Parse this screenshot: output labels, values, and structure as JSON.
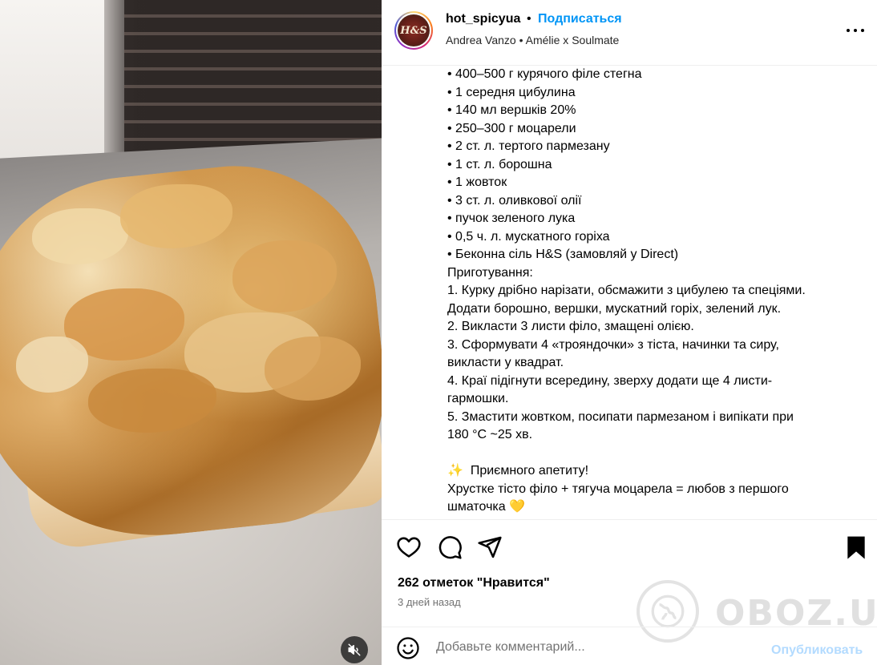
{
  "media": {
    "mute_icon": "volume-muted-icon"
  },
  "post": {
    "username": "hot_spicyua",
    "separator": "•",
    "follow_label": "Подписаться",
    "audio_artist": "Andrea Vanzo",
    "audio_separator": "•",
    "audio_track": "Amélie x Soulmate",
    "avatar_text": "H&S",
    "more_icon": "more-options-icon"
  },
  "caption": {
    "lines": [
      "• 400–500 г курячого філе стегна",
      "• 1 середня цибулина",
      "• 140 мл вершків 20%",
      "• 250–300 г моцарели",
      "• 2 ст. л. тертого пармезану",
      "• 1 ст. л. борошна",
      "• 1 жовток",
      "• 3 ст. л. оливкової олії",
      "• пучок зеленого лука",
      "• 0,5 ч. л. мускатного горіха",
      "• Беконна сіль H&S (замовляй у Direct)",
      "Приготування:",
      "1. Курку дрібно нарізати, обсмажити з цибулею та спеціями.",
      "Додати борошно, вершки, мускатний горіх, зелений лук.",
      "2. Викласти 3 листи філо, змащені олією.",
      "3. Сформувати 4 «трояндочки» з тіста, начинки та сиру,",
      "викласти у квадрат.",
      "4. Краї підігнути всередину, зверху додати ще 4 листи-",
      "гармошки.",
      "5. Змастити жовтком, посипати пармезаном і випікати при",
      "180 °С ~25 хв.",
      "",
      "✨  Приємного апетиту!",
      "Хрустке тісто філо + тягуча моцарела = любов з першого",
      "шматочка 💛"
    ]
  },
  "actions": {
    "like_icon": "heart-icon",
    "comment_icon": "comment-icon",
    "share_icon": "share-icon",
    "save_icon": "bookmark-icon",
    "likes_text": "262 отметок \"Нравится\"",
    "time_text": "3 дней назад"
  },
  "comment": {
    "placeholder": "Добавьте комментарий...",
    "post_label": "Опубликовать",
    "emoji_icon": "emoji-icon"
  },
  "watermark": {
    "text": "OBOZ.UA"
  },
  "colors": {
    "link_blue": "#0095f6",
    "post_disabled": "#b3dbff",
    "secondary_text": "#737373",
    "divider": "#efefef"
  }
}
